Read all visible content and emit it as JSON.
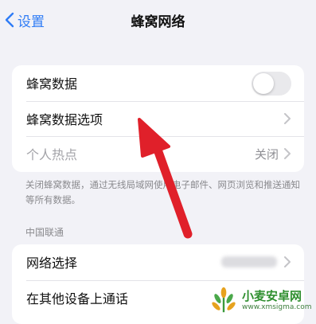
{
  "nav": {
    "back_label": "设置",
    "title": "蜂窝网络"
  },
  "group1": {
    "rows": [
      {
        "label": "蜂窝数据",
        "toggle_on": false
      },
      {
        "label": "蜂窝数据选项"
      },
      {
        "label": "个人热点",
        "value": "关闭"
      }
    ]
  },
  "footnote": "关闭蜂窝数据，通过无线局域网使用电子邮件、网页浏览和推送通知等所有数据。",
  "section_header": "中国联通",
  "group2": {
    "rows": [
      {
        "label": "网络选择"
      },
      {
        "label": "在其他设备上通话"
      }
    ]
  },
  "watermark": {
    "title": "小麦安卓网",
    "url": "www.xmsigma.com"
  },
  "colors": {
    "accent": "#2f7cf6",
    "arrow": "#e0202a",
    "background": "#f2f2f7"
  }
}
